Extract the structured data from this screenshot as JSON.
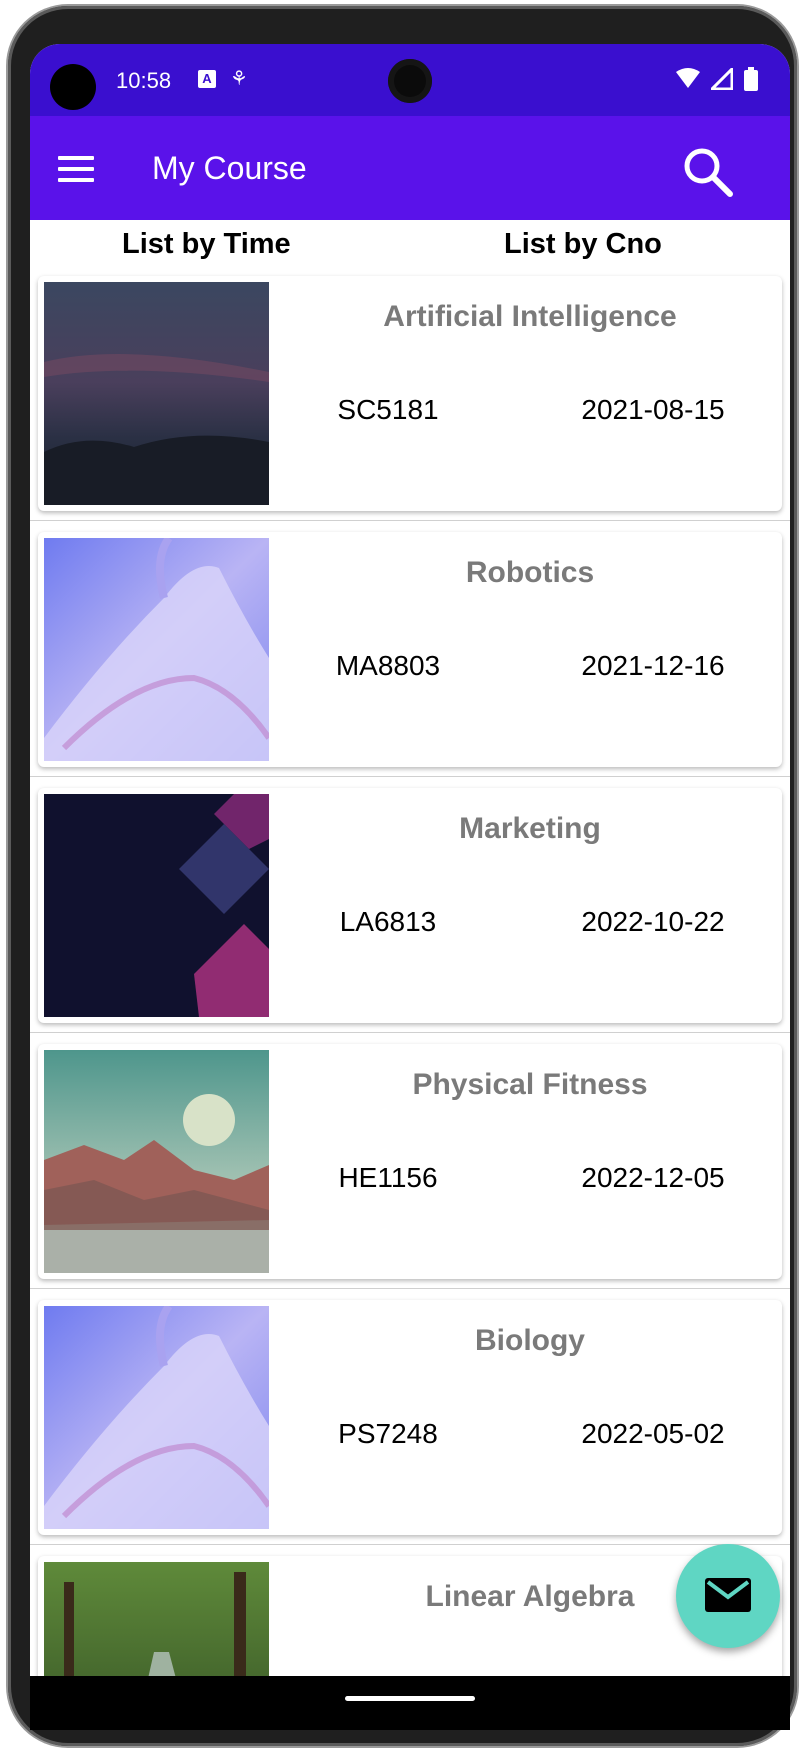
{
  "status_bar": {
    "time": "10:58",
    "icons": [
      "notification-a-icon",
      "accessibility-icon",
      "wifi-icon",
      "signal-icon",
      "battery-icon"
    ]
  },
  "app_bar": {
    "title": "My Course",
    "menu_icon": "hamburger-menu-icon",
    "search_icon": "search-icon",
    "color": "#5a12ea"
  },
  "tabs": [
    {
      "label": "List by Time"
    },
    {
      "label": "List by Cno"
    }
  ],
  "courses": [
    {
      "name": "Artificial Intelligence",
      "cno": "SC5181",
      "date": "2021-08-15",
      "image": "night-sky-landscape"
    },
    {
      "name": "Robotics",
      "cno": "MA8803",
      "date": "2021-12-16",
      "image": "purple-fabric-waves"
    },
    {
      "name": "Marketing",
      "cno": "LA6813",
      "date": "2022-10-22",
      "image": "dark-diamond-shapes"
    },
    {
      "name": "Physical Fitness",
      "cno": "HE1156",
      "date": "2022-12-05",
      "image": "desert-mountains-moon"
    },
    {
      "name": "Biology",
      "cno": "PS7248",
      "date": "2022-05-02",
      "image": "purple-fabric-waves"
    },
    {
      "name": "Linear Algebra",
      "cno": "",
      "date": "",
      "image": "forest-road"
    }
  ],
  "fab": {
    "icon": "mail-icon",
    "color": "#5fd6c3"
  }
}
